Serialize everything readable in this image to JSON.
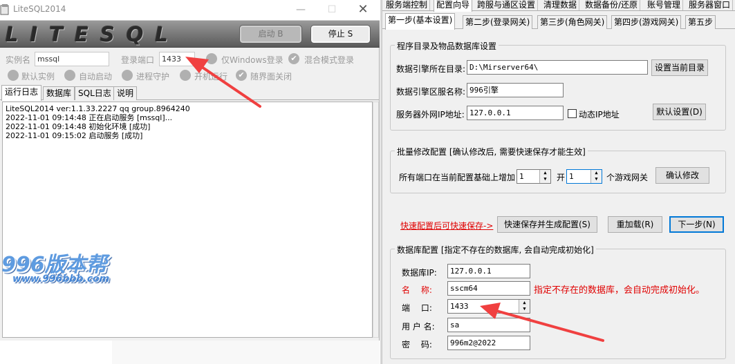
{
  "left": {
    "title": "LiteSQL2014",
    "logo": "LITESQL",
    "start_btn": "启动 B",
    "stop_btn": "停止 S",
    "instance_label": "实例名",
    "instance_value": "mssql",
    "port_label": "登录端口",
    "port_value": "1433",
    "opt_windows_login": "仅Windows登录",
    "opt_mixed_login": "混合模式登录",
    "opt_default_instance": "默认实例",
    "opt_auto_start": "自动启动",
    "opt_process_guard": "进程守护",
    "opt_boot_run": "开机运行",
    "opt_close_with_ui": "随界面关闭",
    "tabs": [
      "运行日志",
      "数据库",
      "SQL日志",
      "说明"
    ],
    "log_lines": [
      "LiteSQL2014 ver:1.1.33.2227 qq group.8964240",
      "2022-11-01 09:14:48 正在启动服务 [mssql]...",
      "2022-11-01 09:14:48 初始化环境 [成功]",
      "2022-11-01 09:15:02 启动服务 [成功]"
    ],
    "watermark_top": "996版本帮",
    "watermark_bottom": "www.996bbb.com"
  },
  "right": {
    "menu": [
      "服务端控制",
      "配置向导",
      "跨服与通区设置",
      "清理数据",
      "数据备份/还原",
      "账号管理",
      "服务器窗口"
    ],
    "subtabs": [
      "第一步(基本设置)",
      "第二步(登录网关)",
      "第三步(角色网关)",
      "第四步(游戏网关)",
      "第五步"
    ],
    "group1_title": "程序目录及物品数据库设置",
    "engine_dir_label": "数据引擎所在目录:",
    "engine_dir_value": "D:\\Mirserver64\\",
    "set_dir_btn": "设置当前目录",
    "engine_name_label": "数据引擎区服名称:",
    "engine_name_value": "996引擎",
    "ip_label": "服务器外网IP地址:",
    "ip_value": "127.0.0.1",
    "dynamic_ip_label": "动态IP地址",
    "default_btn": "默认设置(D)",
    "group2_title": "批量修改配置 [确认修改后, 需要快速保存才能生效]",
    "batch_label": "所有端口在当前配置基础上增加",
    "batch_value": "1",
    "open_label": "开",
    "open_value": "1",
    "gateway_label": "个游戏网关",
    "confirm_btn": "确认修改",
    "quick_link": "快速配置后可快速保存->",
    "quick_save_btn": "快速保存并生成配置(S)",
    "reload_btn": "重加载(R)",
    "next_btn": "下一步(N)",
    "group3_title": "数据库配置 [指定不存在的数据库, 会自动完成初始化]",
    "db_ip_label": "数据库IP:",
    "db_ip_value": "127.0.0.1",
    "db_name_label": "名　 称:",
    "db_name_value": "sscm64",
    "db_note": "指定不存在的数据库，会自动完成初始化。",
    "db_port_label": "端　 口:",
    "db_port_value": "1433",
    "db_user_label": "用 户 名:",
    "db_user_value": "sa",
    "db_pass_label": "密　 码:",
    "db_pass_value": "996m2@2022"
  },
  "colors": {
    "arrow": "#f04040",
    "warning_text": "#e00000"
  }
}
